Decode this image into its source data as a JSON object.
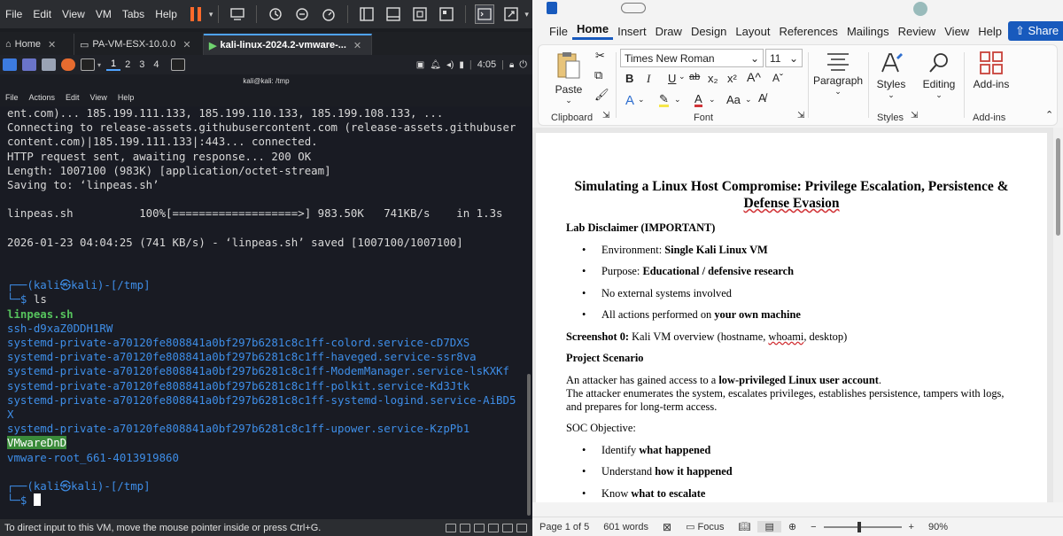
{
  "vmware": {
    "menu": [
      "File",
      "Edit",
      "View",
      "VM",
      "Tabs",
      "Help"
    ],
    "tabs": [
      {
        "label": "Home",
        "active": false
      },
      {
        "label": "PA-VM-ESX-10.0.0",
        "active": false
      },
      {
        "label": "kali-linux-2024.2-vmware-...",
        "active": true
      }
    ],
    "kali_panel": {
      "workspaces": [
        "1",
        "2",
        "3",
        "4"
      ],
      "clock": "4:05"
    },
    "terminal": {
      "window_title": "kali@kali: /tmp",
      "menu": [
        "File",
        "Actions",
        "Edit",
        "View",
        "Help"
      ],
      "lines": [
        "ent.com)... 185.199.111.133, 185.199.110.133, 185.199.108.133, ...",
        "Connecting to release-assets.githubusercontent.com (release-assets.githubuser",
        "content.com)|185.199.111.133|:443... connected.",
        "HTTP request sent, awaiting response... 200 OK",
        "Length: 1007100 (983K) [application/octet-stream]",
        "Saving to: ‘linpeas.sh’",
        "",
        "linpeas.sh          100%[===================>] 983.50K   741KB/s    in 1.3s",
        "",
        "2026-01-23 04:04:25 (741 KB/s) - ‘linpeas.sh’ saved [1007100/1007100]",
        "",
        ""
      ],
      "prompt_user": "(kali㉿kali)-[/tmp]",
      "command": "ls",
      "ls_output": [
        {
          "text": "linpeas.sh",
          "style": "green"
        },
        {
          "text": "ssh-d9xaZ0DDH1RW",
          "style": "blue"
        },
        {
          "text": "systemd-private-a70120fe808841a0bf297b6281c8c1ff-colord.service-cD7DXS",
          "style": "blue"
        },
        {
          "text": "systemd-private-a70120fe808841a0bf297b6281c8c1ff-haveged.service-ssr8va",
          "style": "blue"
        },
        {
          "text": "systemd-private-a70120fe808841a0bf297b6281c8c1ff-ModemManager.service-lsKXKf",
          "style": "blue"
        },
        {
          "text": "systemd-private-a70120fe808841a0bf297b6281c8c1ff-polkit.service-Kd3Jtk",
          "style": "blue"
        },
        {
          "text": "systemd-private-a70120fe808841a0bf297b6281c8c1ff-systemd-logind.service-AiBD5",
          "style": "blue"
        },
        {
          "text": "X",
          "style": "blue"
        },
        {
          "text": "systemd-private-a70120fe808841a0bf297b6281c8c1ff-upower.service-KzpPb1",
          "style": "blue"
        },
        {
          "text": "VMwareDnD",
          "style": "highlight"
        },
        {
          "text": "vmware-root_661-4013919860",
          "style": "blue"
        }
      ],
      "prompt_user_2": "(kali㉿kali)-[/tmp]",
      "prompt_dollar": "$"
    },
    "status": "To direct input to this VM, move the mouse pointer inside or press Ctrl+G."
  },
  "word": {
    "tabs": [
      "File",
      "Home",
      "Insert",
      "Draw",
      "Design",
      "Layout",
      "References",
      "Mailings",
      "Review",
      "View",
      "Help"
    ],
    "active_tab": "Home",
    "share_label": "Share",
    "ribbon": {
      "paste_label": "Paste",
      "clipboard_label": "Clipboard",
      "font_name": "Times New Roman",
      "font_size": "11",
      "font_label": "Font",
      "paragraph_label": "Paragraph",
      "styles_label": "Styles",
      "styles_group_label": "Styles",
      "editing_label": "Editing",
      "addins_label": "Add-ins",
      "addins_group_label": "Add-ins",
      "fmt": {
        "bold": "B",
        "italic": "I",
        "underline": "U",
        "strike": "ab",
        "sub": "x₂",
        "sup": "x²",
        "clear": "A",
        "color_a": "A",
        "highlight": "✎",
        "fontcolor": "A",
        "case": "Aa"
      }
    },
    "doc": {
      "title_line1": "Simulating a Linux Host Compromise: Privilege Escalation, Persistence &",
      "title_line2": "Defense Evasion",
      "disclaimer_heading": "Lab Disclaimer (IMPORTANT)",
      "bullets1": [
        {
          "plain": "Environment: ",
          "bold": "Single Kali Linux VM"
        },
        {
          "plain": "Purpose: ",
          "bold": "Educational / defensive research"
        },
        {
          "plain": "No external systems involved",
          "bold": ""
        },
        {
          "plain": "All actions performed on ",
          "bold": "your own machine"
        }
      ],
      "screenshot_label": "Screenshot 0:",
      "screenshot_text": " Kali VM overview (hostname, ",
      "screenshot_whoami": "whoami",
      "screenshot_end": ", desktop)",
      "scenario_heading": "Project Scenario",
      "scenario_p1_plain": "An attacker has gained access to a ",
      "scenario_p1_bold": "low-privileged Linux user account",
      "scenario_p1_end": ".",
      "scenario_p2": "The attacker enumerates the system, escalates privileges, establishes persistence, tampers with logs,",
      "scenario_p3": "and prepares for long-term access.",
      "soc_heading": "SOC Objective:",
      "bullets2": [
        {
          "plain": "Identify ",
          "bold": "what happened"
        },
        {
          "plain": "Understand ",
          "bold": "how it happened"
        },
        {
          "plain": "Know ",
          "bold": "what to escalate"
        }
      ]
    },
    "status": {
      "page": "Page 1 of 5",
      "words": "601 words",
      "focus": "Focus",
      "zoom": "90%"
    }
  }
}
